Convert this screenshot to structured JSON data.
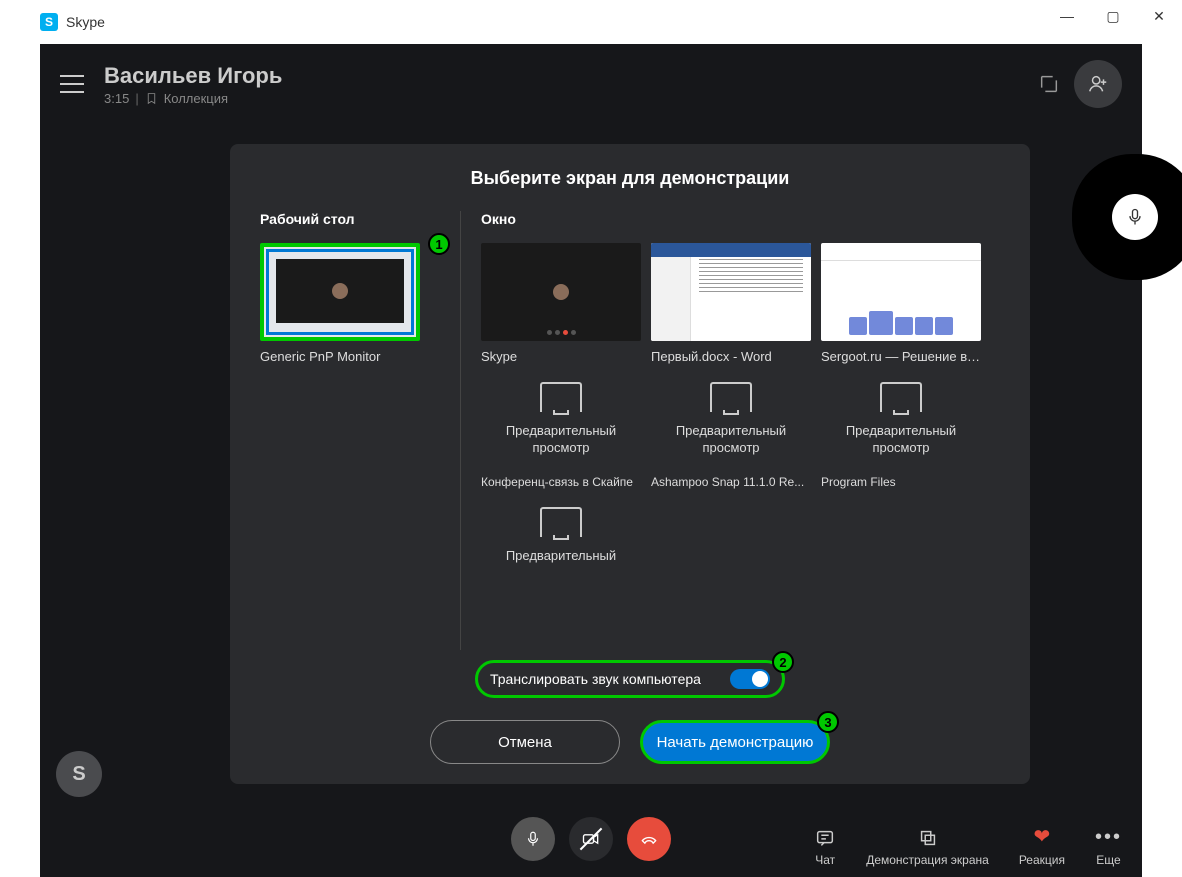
{
  "window": {
    "title": "Skype",
    "minimize": "—",
    "maximize": "▢",
    "close": "✕"
  },
  "header": {
    "name": "Васильев Игорь",
    "duration": "3:15",
    "collection": "Коллекция"
  },
  "dialog": {
    "title": "Выберите экран для демонстрации",
    "desktop_label": "Рабочий стол",
    "window_label": "Окно",
    "desktop_item": "Generic PnP Monitor",
    "windows": [
      {
        "label": "Skype"
      },
      {
        "label": "Первый.docx - Word"
      },
      {
        "label": "Sergoot.ru — Решение ва..."
      }
    ],
    "preview_label": "Предварительный просмотр",
    "no_preview_items": [
      "Конференц-связь в Скайпе",
      "Ashampoo Snap 11.1.0 Re...",
      "Program Files"
    ],
    "extra_preview": "Предварительный",
    "badges": {
      "b1": "1",
      "b2": "2",
      "b3": "3"
    },
    "audio_label": "Транслировать звук компьютера",
    "cancel": "Отмена",
    "start": "Начать демонстрацию"
  },
  "bottom": {
    "chat": "Чат",
    "share": "Демонстрация экрана",
    "reaction": "Реакция",
    "more": "Еще"
  },
  "avatar_letter": "S"
}
